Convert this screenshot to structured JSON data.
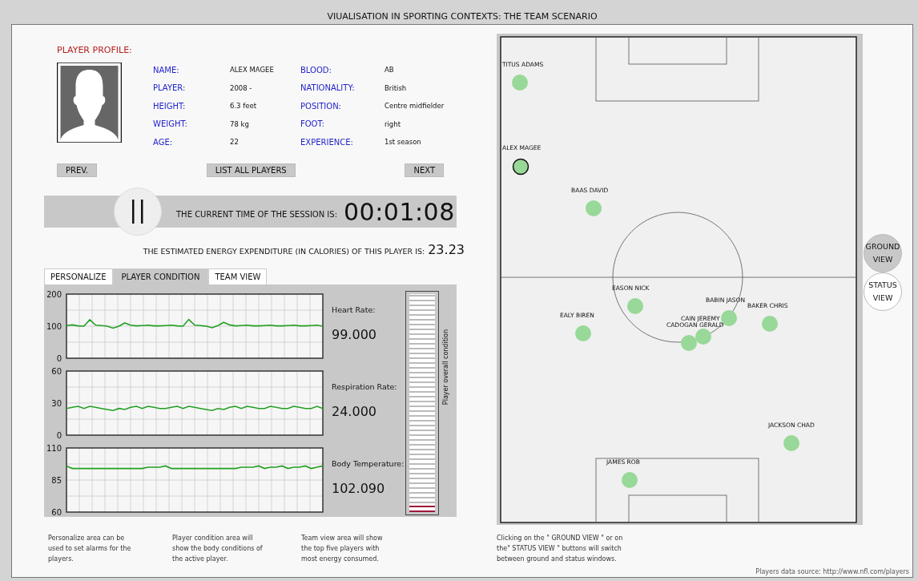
{
  "window": {
    "title": "VIUALISATION IN SPORTING CONTEXTS: THE TEAM SCENARIO"
  },
  "profile": {
    "heading": "PLAYER PROFILE:",
    "fields": [
      {
        "label": "NAME:",
        "value": "ALEX MAGEE"
      },
      {
        "label": "BLOOD:",
        "value": "AB"
      },
      {
        "label": "PLAYER:",
        "value": "2008 -"
      },
      {
        "label": "NATIONALITY:",
        "value": "British"
      },
      {
        "label": "HEIGHT:",
        "value": "6.3 feet"
      },
      {
        "label": "POSITION:",
        "value": "Centre midfielder"
      },
      {
        "label": "WEIGHT:",
        "value": "78 kg"
      },
      {
        "label": "FOOT:",
        "value": "right"
      },
      {
        "label": "AGE:",
        "value": "22"
      },
      {
        "label": "EXPERIENCE:",
        "value": "1st season"
      }
    ],
    "buttons": [
      "PREV.",
      "LIST ALL PLAYERS",
      "NEXT"
    ]
  },
  "session": {
    "time_label": "THE CURRENT TIME OF THE SESSION IS:",
    "time": "00:01:08",
    "paused": false
  },
  "energy": {
    "label": "THE ESTIMATED ENERGY EXPENDITURE (IN CALORIES) OF THIS PLAYER IS:",
    "value": "23.23"
  },
  "tabs": [
    {
      "label": "PERSONALIZE",
      "selected": false
    },
    {
      "label": "PLAYER CONDITION",
      "selected": true
    },
    {
      "label": "TEAM VIEW",
      "selected": false
    }
  ],
  "metrics": [
    {
      "label": "Heart Rate:",
      "value": "99.000",
      "chart_data": {
        "type": "line",
        "grid": true,
        "ylim": [
          0,
          200
        ],
        "yticks": [
          0,
          100,
          200
        ],
        "series": [
          {
            "color": "#22a022",
            "values": [
              102,
              104,
              101,
              100,
              120,
              103,
              102,
              100,
              94,
              100,
              110,
              103,
              101,
              102,
              103,
              101,
              101,
              102,
              103,
              101,
              100,
              121,
              103,
              102,
              100,
              95,
              102,
              112,
              104,
              101,
              102,
              103,
              101,
              101,
              102,
              103,
              101,
              101,
              102,
              103,
              101,
              101,
              102,
              103,
              100
            ]
          }
        ]
      }
    },
    {
      "label": "Respiration Rate:",
      "value": "24.000",
      "chart_data": {
        "type": "line",
        "grid": true,
        "ylim": [
          0,
          60
        ],
        "yticks": [
          0,
          30,
          60
        ],
        "series": [
          {
            "color": "#22a022",
            "values": [
              25,
              26,
              27,
              25,
              27,
              26,
              25,
              24,
              23,
              25,
              24,
              26,
              27,
              25,
              27,
              26,
              25,
              25,
              26,
              27,
              25,
              27,
              26,
              25,
              24,
              23,
              25,
              24,
              26,
              27,
              25,
              27,
              26,
              25,
              25,
              27,
              26,
              25,
              25,
              27,
              26,
              25,
              25,
              27,
              25
            ]
          }
        ]
      }
    },
    {
      "label": "Body Temperature:",
      "value": "102.090",
      "chart_data": {
        "type": "line",
        "grid": true,
        "ylim": [
          60,
          110
        ],
        "yticks": [
          60,
          85,
          110
        ],
        "series": [
          {
            "color": "#22a022",
            "values": [
              96,
              94,
              94,
              94,
              94,
              94,
              94,
              94,
              94,
              94,
              94,
              94,
              94,
              94,
              95,
              95,
              95,
              96,
              94,
              94,
              94,
              94,
              94,
              94,
              94,
              94,
              94,
              94,
              94,
              94,
              95,
              95,
              95,
              96,
              94,
              95,
              95,
              96,
              94,
              95,
              95,
              96,
              94,
              95,
              96
            ]
          }
        ]
      }
    }
  ],
  "condition": {
    "label": "Player overall condition",
    "level": 0.04
  },
  "pitch": {
    "players": [
      {
        "name": "TITUS ADAMS",
        "selected": false
      },
      {
        "name": "ALEX MAGEE",
        "selected": true
      },
      {
        "name": "BAAS DAVID",
        "selected": false
      },
      {
        "name": "EASON NICK",
        "selected": false
      },
      {
        "name": "EALY BIREN",
        "selected": false
      },
      {
        "name": "BABIN JASON",
        "selected": false
      },
      {
        "name": "BAKER CHRIS",
        "selected": false
      },
      {
        "name": "CAIN JEREMY",
        "selected": false
      },
      {
        "name": "CADOGAN GERALD",
        "selected": false
      },
      {
        "name": "JACKSON CHAD",
        "selected": false
      },
      {
        "name": "JAMES ROB",
        "selected": false
      }
    ]
  },
  "views": [
    {
      "label": [
        "GROUND",
        "VIEW"
      ],
      "selected": true
    },
    {
      "label": [
        "STATUS",
        "VIEW"
      ],
      "selected": false
    }
  ],
  "notes": [
    "Personalize area can be used to set alarms for the players.",
    "Player condition area will show the body conditions of the active player.",
    "Team view area will show the top five players with most energy consumed.",
    "Clicking on the \" GROUND VIEW \" or on the\" STATUS VIEW \" buttons will switch between ground and status windows."
  ],
  "source": "Players data source: http://www.nfl.com/players"
}
